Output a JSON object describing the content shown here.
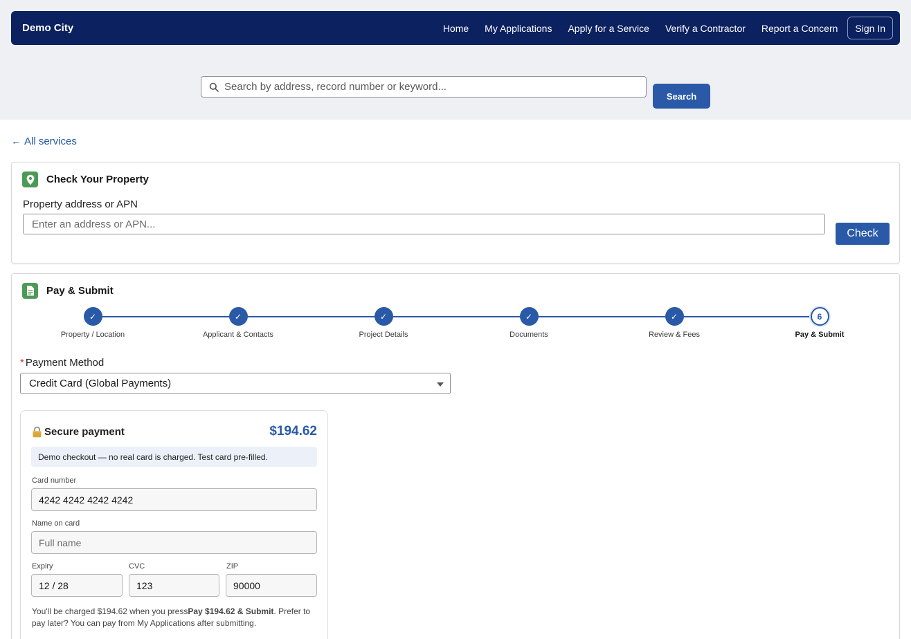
{
  "header": {
    "brand": "Demo City",
    "nav": [
      "Home",
      "My Applications",
      "Apply for a Service",
      "Verify a Contractor",
      "Report a Concern"
    ],
    "signin": "Sign In"
  },
  "search": {
    "placeholder": "Search by address, record number or keyword...",
    "button": "Search"
  },
  "back_link": "All services",
  "property_card": {
    "title": "Check Your Property",
    "field_label": "Property address or APN",
    "placeholder": "Enter an address or APN...",
    "button": "Check"
  },
  "pay_card": {
    "title": "Pay & Submit",
    "steps": [
      {
        "label": "Property / Location",
        "state": "done",
        "mark": "✓"
      },
      {
        "label": "Applicant & Contacts",
        "state": "done",
        "mark": "✓"
      },
      {
        "label": "Project Details",
        "state": "done",
        "mark": "✓"
      },
      {
        "label": "Documents",
        "state": "done",
        "mark": "✓"
      },
      {
        "label": "Review & Fees",
        "state": "done",
        "mark": "✓"
      },
      {
        "label": "Pay & Submit",
        "state": "current",
        "mark": "6"
      }
    ],
    "payment_method_label": "Payment Method",
    "required_mark": "*",
    "payment_method_value": "Credit Card (Global Payments)",
    "secure": {
      "title": "Secure payment",
      "amount": "$194.62",
      "notice": "Demo checkout — no real card is charged. Test card pre-filled.",
      "card_number_label": "Card number",
      "card_number_value": "4242 4242 4242 4242",
      "name_label": "Name on card",
      "name_placeholder": "Full name",
      "expiry_label": "Expiry",
      "expiry_value": "12 / 28",
      "cvc_label": "CVC",
      "cvc_value": "123",
      "zip_label": "ZIP",
      "zip_value": "90000",
      "footer_pre": "You'll be charged $194.62 when you press",
      "footer_bold": "Pay $194.62 & Submit",
      "footer_post": ". Prefer to pay later? You can pay from My Applications after submitting."
    }
  },
  "colors": {
    "navbar": "#0b2160",
    "primary": "#2a5aa7",
    "icon_green": "#4b9a56",
    "required": "#c23934"
  }
}
